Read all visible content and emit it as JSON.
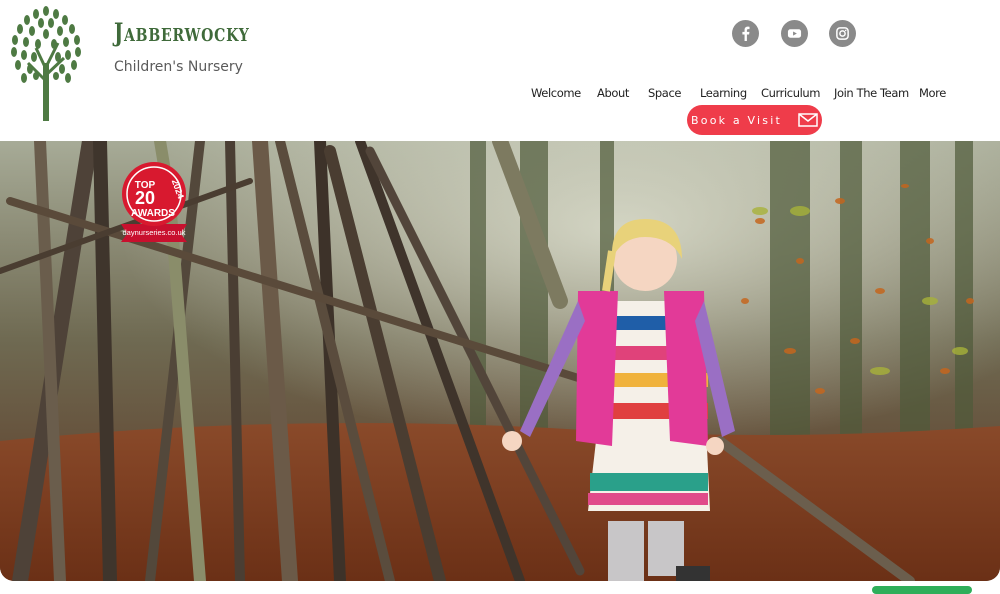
{
  "brand": {
    "title": "Jabberwocky",
    "subtitle": "Children's Nursery",
    "logo_icon": "tree-icon",
    "green": "#3f6a3a"
  },
  "social": [
    {
      "name": "facebook-icon"
    },
    {
      "name": "youtube-icon"
    },
    {
      "name": "instagram-icon"
    }
  ],
  "nav": {
    "items": [
      "Welcome",
      "About",
      "Space",
      "Learning",
      "Curriculum",
      "Join The Team",
      "More"
    ]
  },
  "cta": {
    "label": "Book a Visit",
    "icon": "envelope-icon",
    "color": "#ef3c4a"
  },
  "badge": {
    "top": "TOP",
    "number": "20",
    "awards": "AWARDS",
    "year": "2024",
    "site": "daynurseries.co.uk"
  }
}
